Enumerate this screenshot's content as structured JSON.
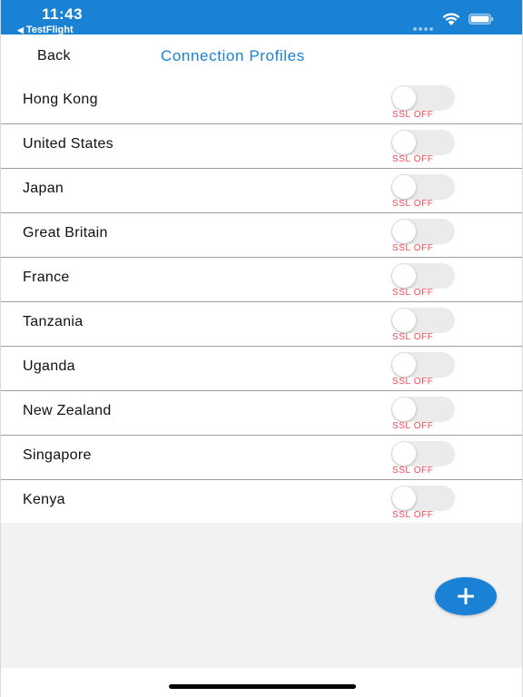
{
  "status_bar": {
    "time": "11:43",
    "back_app": "TestFlight",
    "back_arrow": "◀"
  },
  "nav": {
    "back_label": "Back",
    "title": "Connection Profiles"
  },
  "profiles": [
    {
      "name": "Hong Kong",
      "ssl_status": "SSL OFF",
      "ssl_enabled": false
    },
    {
      "name": "United States",
      "ssl_status": "SSL OFF",
      "ssl_enabled": false
    },
    {
      "name": "Japan",
      "ssl_status": "SSL OFF",
      "ssl_enabled": false
    },
    {
      "name": "Great Britain",
      "ssl_status": "SSL OFF",
      "ssl_enabled": false
    },
    {
      "name": "France",
      "ssl_status": "SSL OFF",
      "ssl_enabled": false
    },
    {
      "name": "Tanzania",
      "ssl_status": "SSL OFF",
      "ssl_enabled": false
    },
    {
      "name": "Uganda",
      "ssl_status": "SSL OFF",
      "ssl_enabled": false
    },
    {
      "name": "New Zealand",
      "ssl_status": "SSL OFF",
      "ssl_enabled": false
    },
    {
      "name": "Singapore",
      "ssl_status": "SSL OFF",
      "ssl_enabled": false
    },
    {
      "name": "Kenya",
      "ssl_status": "SSL OFF",
      "ssl_enabled": false
    }
  ],
  "add_button": {
    "icon": "plus-icon",
    "symbol": "+"
  },
  "colors": {
    "accent": "#1a82d4",
    "ssl_off_text": "#ef4a55",
    "toggle_off": "#ebebeb",
    "empty_area": "#f2f2f2"
  }
}
